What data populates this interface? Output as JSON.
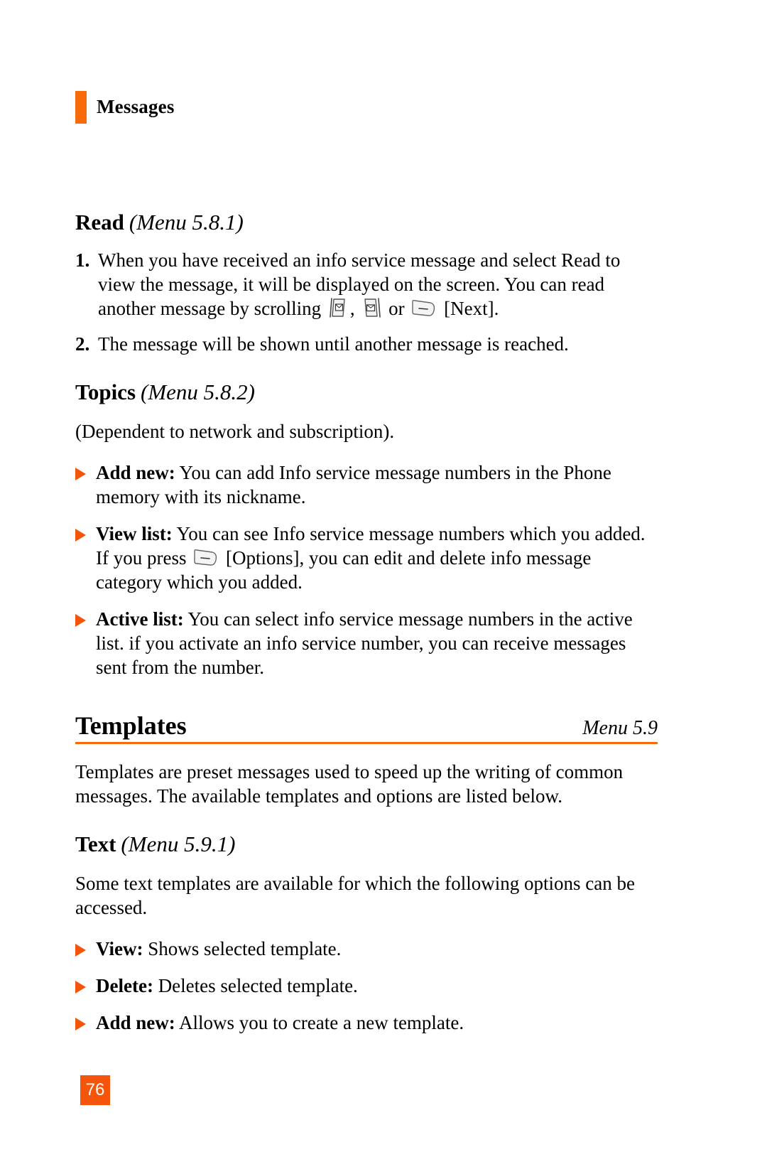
{
  "running_header": {
    "title": "Messages",
    "accent_color": "#F96A0B"
  },
  "sections": {
    "read": {
      "name": "Read",
      "menu": "(Menu 5.8.1)",
      "steps": [
        {
          "number": "1.",
          "text_part_1": "When you have received an info service message and select Read to view the message, it will be displayed on the screen. You can read another message by scrolling ",
          "icon_1": "nav-up-key-icon",
          "text_part_2": ", ",
          "icon_2": "nav-down-key-icon",
          "text_part_3": " or ",
          "icon_3": "soft-key-icon",
          "text_part_4": " [Next]."
        },
        {
          "number": "2.",
          "text_part_1": "The message will be shown until another message is reached."
        }
      ]
    },
    "topics": {
      "name": "Topics",
      "menu": "(Menu 5.8.2)",
      "intro": "(Dependent to network and subscription).",
      "bullets": [
        {
          "lead": "Add new:",
          "text_part_1": " You can add Info service message numbers in the Phone memory with its nickname."
        },
        {
          "lead": "View list:",
          "text_part_1": " You can see Info service message numbers which you added. If you press ",
          "icon_1": "soft-key-icon",
          "text_part_2": " [Options], you can edit and delete info message category which you added."
        },
        {
          "lead": "Active list:",
          "text_part_1": " You can select info service message numbers in the active list. if you activate an info service number, you can receive messages sent from the number."
        }
      ]
    },
    "templates": {
      "name": "Templates",
      "menu": "Menu 5.9",
      "rule_color": "#F96A0B",
      "intro": "Templates are preset messages used to speed up the writing of common messages. The available templates and options are listed below."
    },
    "text": {
      "name": "Text",
      "menu": "(Menu 5.9.1)",
      "intro": "Some text templates are available for which the following options can be accessed.",
      "bullets": [
        {
          "lead": "View:",
          "text_part_1": " Shows selected template."
        },
        {
          "lead": "Delete:",
          "text_part_1": " Deletes selected template."
        },
        {
          "lead": "Add new:",
          "text_part_1": " Allows you to create a new template."
        }
      ]
    }
  },
  "footer": {
    "page_number": "76",
    "badge_color": "#F5550A"
  }
}
